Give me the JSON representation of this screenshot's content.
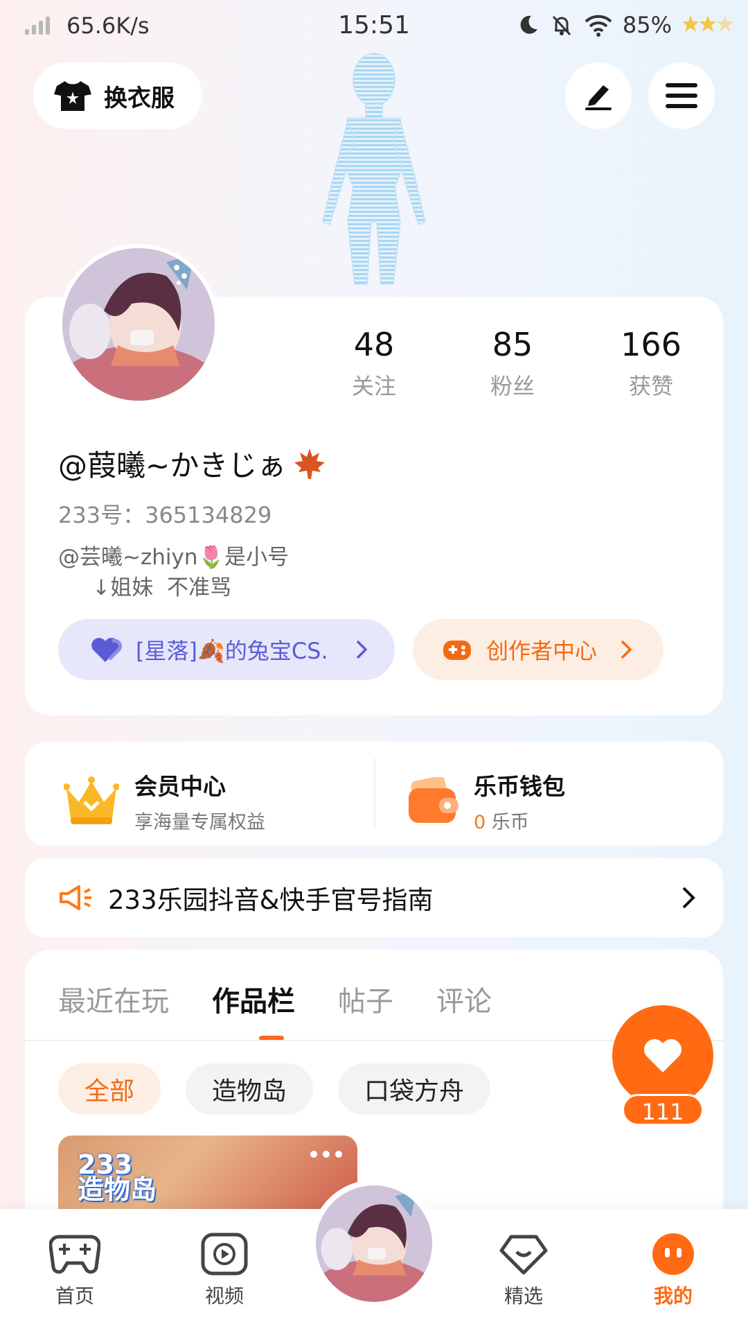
{
  "status_bar": {
    "speed": "65.6K/s",
    "time": "15:51",
    "battery": "85%"
  },
  "top": {
    "dress_label": "换衣服"
  },
  "profile": {
    "stats": [
      {
        "num": "48",
        "label": "关注"
      },
      {
        "num": "85",
        "label": "粉丝"
      },
      {
        "num": "166",
        "label": "获赞"
      }
    ],
    "username": "@葭曦~かきじぁ",
    "user_id": "233号：365134829",
    "bio": "@芸曦~zhiyn🌷是小号\n     ↓姐妹  不准骂",
    "group_pill": "[星落]🍂的兔宝CS.",
    "creator_pill": "创作者中心"
  },
  "member": {
    "title": "会员中心",
    "subtitle": "享海量专属权益"
  },
  "wallet": {
    "title": "乐币钱包",
    "amount": "0",
    "unit": "乐币"
  },
  "notice": {
    "text": "233乐园抖音&快手官号指南"
  },
  "tabs": [
    "最近在玩",
    "作品栏",
    "帖子",
    "评论"
  ],
  "active_tab": "作品栏",
  "chips": [
    "全部",
    "造物岛",
    "口袋方舟"
  ],
  "thumb": {
    "logo_line1": "233",
    "logo_line2": "造物岛"
  },
  "fab": {
    "count": "111"
  },
  "nav": {
    "home": "首页",
    "video": "视频",
    "featured": "精选",
    "mine": "我的"
  },
  "colors": {
    "accent": "#ff6a13",
    "purple": "#5a5cd4"
  }
}
